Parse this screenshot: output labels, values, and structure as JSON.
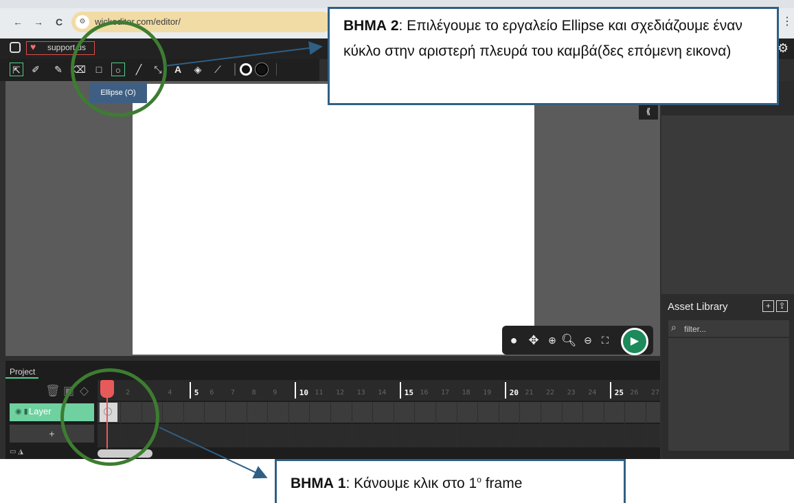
{
  "browser": {
    "url": "wickeditor.com/editor/",
    "back_icon": "←",
    "forward_icon": "→",
    "reload_icon": "C",
    "menu_icon": "⋮"
  },
  "app": {
    "support_label": "support us",
    "tools": [
      "cursor-icon",
      "brush-icon",
      "pencil-icon",
      "eraser-icon",
      "rectangle-icon",
      "ellipse-icon",
      "line-icon",
      "path-cursor-icon",
      "text-icon",
      "fill-bucket-icon",
      "eyedropper-icon"
    ],
    "selected_tool": "ellipse-icon",
    "tooltip": "Ellipse (O)",
    "collapse_label": "⟪",
    "asset_library": {
      "title": "Asset Library",
      "filter_placeholder": "filter..."
    },
    "timeline": {
      "tab": "Project",
      "layer_name": "Layer",
      "add_layer": "+",
      "frames": [
        "2",
        "",
        "4",
        "5",
        "6",
        "7",
        "8",
        "9",
        "10",
        "11",
        "12",
        "13",
        "14",
        "15",
        "16",
        "17",
        "18",
        "19",
        "20",
        "21",
        "22",
        "23",
        "24",
        "25",
        "26",
        "27"
      ],
      "major_frames": [
        "5",
        "10",
        "15",
        "20",
        "25"
      ]
    }
  },
  "callouts": {
    "step2_bold": "ΒΗΜΑ 2",
    "step2_text": ": Επιλέγουμε το εργαλείο Ellipse και σχεδιάζουμε έναν κύκλο στην αριστερή πλευρά του καμβά(δες επόμενη εικονα)",
    "step1_bold": "ΒΗΜΑ 1",
    "step1_text": ": Κάνουμε κλικ στο 1",
    "step1_sup": "ο",
    "step1_tail": " frame"
  },
  "colors": {
    "accent_green": "#4fd18b",
    "callout_border": "#2f5f84",
    "ring": "#3d7d31",
    "playhead": "#e85a5a"
  }
}
